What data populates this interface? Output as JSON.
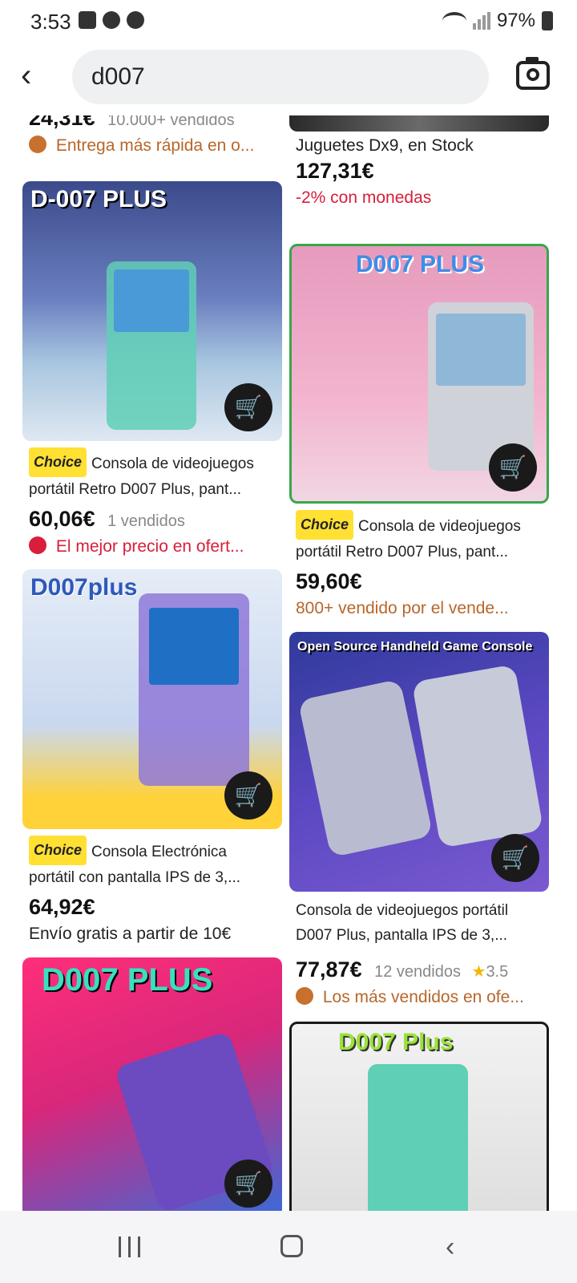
{
  "status_bar": {
    "time": "3:53",
    "battery": "97%"
  },
  "search": {
    "query": "d007"
  },
  "products": {
    "top_left_partial": {
      "price": "24,31€",
      "sold": "10.000+ vendidos",
      "note": "Entrega más rápida en o..."
    },
    "top_right_partial": {
      "title": "Juguetes Dx9, en Stock",
      "price": "127,31€",
      "note": "-2% con monedas"
    },
    "p1": {
      "image_title": "D-007 PLUS",
      "badge": "Choice",
      "title": "Consola de videojuegos portátil Retro D007 Plus, pant...",
      "price": "60,06€",
      "sold": "1 vendidos",
      "note": "El mejor precio en ofert..."
    },
    "p2": {
      "image_title": "D007 PLUS",
      "badge": "Choice",
      "title": "Consola de videojuegos portátil Retro D007 Plus, pant...",
      "price": "59,60€",
      "note": "800+ vendido por el vende..."
    },
    "p3": {
      "image_title": "D007plus",
      "badge": "Choice",
      "title": "Consola Electrónica portátil con pantalla IPS de 3,...",
      "price": "64,92€",
      "note": "Envío gratis a partir de 10€"
    },
    "p4": {
      "image_title": "Open Source Handheld Game Console",
      "title": "Consola de videojuegos portátil D007 Plus, pantalla IPS de 3,...",
      "price": "77,87€",
      "sold": "12 vendidos",
      "rating": "3.5",
      "note": "Los más vendidos en ofe..."
    },
    "p5": {
      "image_title": "D007 PLUS"
    },
    "p6": {
      "image_title": "D007 Plus"
    }
  },
  "icons": {
    "cart": "add-to-cart-icon",
    "back": "back-arrow-icon",
    "camera": "camera-icon",
    "star": "star-icon"
  },
  "colors": {
    "choice_badge": "#ffe033",
    "orange_note": "#b8662a",
    "red_note": "#d81e3a"
  }
}
